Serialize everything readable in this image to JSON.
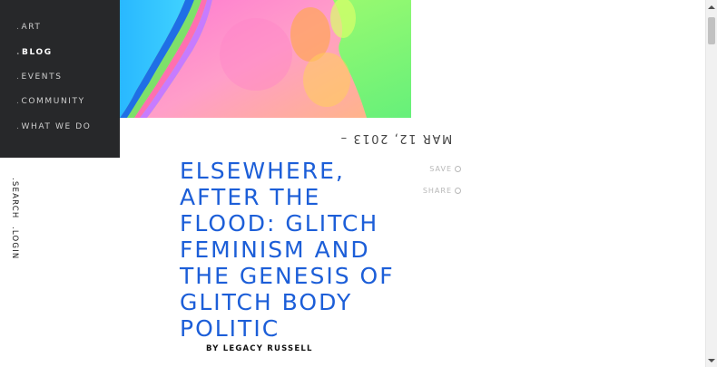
{
  "nav": {
    "items": [
      {
        "label": "ART",
        "active": false
      },
      {
        "label": "BLOG",
        "active": true
      },
      {
        "label": "EVENTS",
        "active": false
      },
      {
        "label": "COMMUNITY",
        "active": false
      },
      {
        "label": "WHAT WE DO",
        "active": false
      }
    ]
  },
  "utility": {
    "search": "SEARCH",
    "login": "LOGIN"
  },
  "article": {
    "date": "MAR 12, 2013 –",
    "title": "ELSEWHERE, AFTER THE FLOOD: GLITCH FEMINISM AND THE GENESIS OF GLITCH BODY POLITIC",
    "author": "BY LEGACY RUSSELL",
    "save_label": "SAVE",
    "share_label": "SHARE"
  },
  "colors": {
    "nav_bg": "#27282a",
    "title": "#1c5ed8"
  },
  "icons": {
    "save": "circle-plus-icon",
    "share": "circle-share-icon"
  }
}
